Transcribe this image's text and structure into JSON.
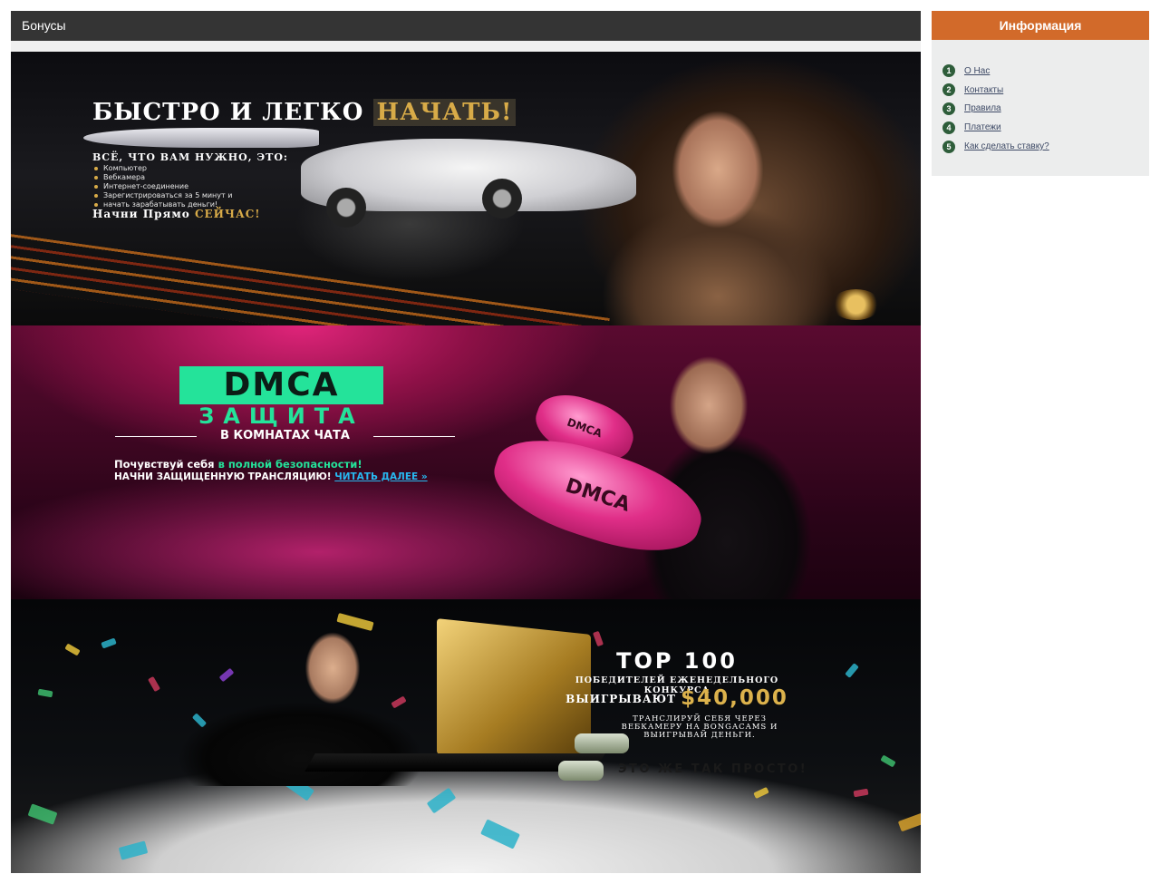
{
  "main": {
    "section_title": "Бонусы"
  },
  "banner1": {
    "headline_white": "БЫСТРО И ЛЕГКО",
    "headline_gold": "НАЧАТЬ!",
    "need_title": "ВСЁ, ЧТО ВАМ НУЖНО, ЭТО:",
    "needs": [
      "Компьютер",
      "Вебкамера",
      "Интернет-соединение",
      "Зарегистрироваться за 5 минут и",
      "начать зарабатывать деньги!"
    ],
    "cta_white": "Начни Прямо",
    "cta_gold": "СЕЙЧАС!"
  },
  "banner2": {
    "logo": "DMCA",
    "protection": "ЗАЩИТА",
    "rooms": "В КОМНАТАХ ЧАТА",
    "feel_white": "Почувствуй себя",
    "feel_green": "в полной безопасности!",
    "start": "НАЧНИ ЗАЩИЩЕННУЮ ТРАНСЛЯЦИЮ!",
    "read_more": "ЧИТАТЬ ДАЛЕЕ »",
    "glove_label": "DMCA"
  },
  "banner3": {
    "top": "TOP 100",
    "winners": "ПОБЕДИТЕЛЕЙ ЕЖЕНЕДЕЛЬНОГО КОНКУРСА",
    "win_label": "ВЫИГРЫВАЮТ",
    "amount": "$40,000",
    "stream_line1": "ТРАНСЛИРУЙ СЕБЯ ЧЕРЕЗ",
    "stream_line2": "ВЕБКАМЕРУ НА BONGACAMS И",
    "stream_line3": "ВЫИГРЫВАЙ ДЕНЬГИ.",
    "easy": "ЭТО ЖЕ ТАК ПРОСТО!"
  },
  "sidebar": {
    "title": "Информация",
    "items": [
      {
        "num": "1",
        "label": "О Нас"
      },
      {
        "num": "2",
        "label": "Контакты"
      },
      {
        "num": "3",
        "label": "Правила"
      },
      {
        "num": "4",
        "label": "Платежи"
      },
      {
        "num": "5",
        "label": "Как сделать ставку?"
      }
    ]
  },
  "colors": {
    "header_dark": "#343434",
    "sidebar_accent": "#d26a2a",
    "number_badge": "#2e5d3a",
    "dmca_green": "#24e39a",
    "gold": "#d8ab48"
  }
}
